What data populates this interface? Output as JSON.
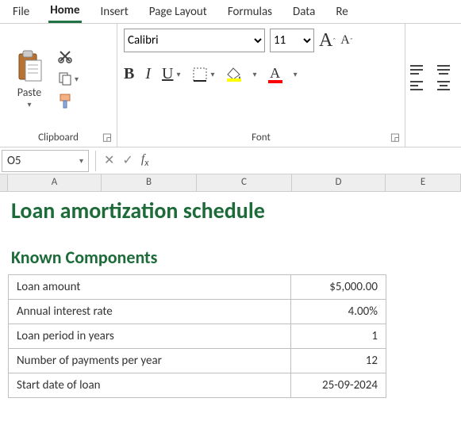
{
  "tabs": {
    "file": "File",
    "home": "Home",
    "insert": "Insert",
    "pageLayout": "Page Layout",
    "formulas": "Formulas",
    "data": "Data",
    "review_partial": "Re"
  },
  "ribbon": {
    "clipboard": {
      "groupLabel": "Clipboard",
      "pasteLabel": "Paste"
    },
    "font": {
      "groupLabel": "Font",
      "fontName": "Calibri",
      "fontSize": "11",
      "bold": "B",
      "italic": "I",
      "underline": "U"
    }
  },
  "fbar": {
    "nameBox": "O5",
    "formula": ""
  },
  "columns": {
    "A": "A",
    "B": "B",
    "C": "C",
    "D": "D",
    "E": "E"
  },
  "sheet": {
    "title": "Loan amortization schedule",
    "subtitle": "Known Components",
    "rows": [
      {
        "label": "Loan amount",
        "value": "$5,000.00"
      },
      {
        "label": "Annual interest rate",
        "value": "4.00%"
      },
      {
        "label": "Loan period in years",
        "value": "1"
      },
      {
        "label": "Number of payments per year",
        "value": "12"
      },
      {
        "label": "Start date of loan",
        "value": "25-09-2024"
      }
    ]
  }
}
